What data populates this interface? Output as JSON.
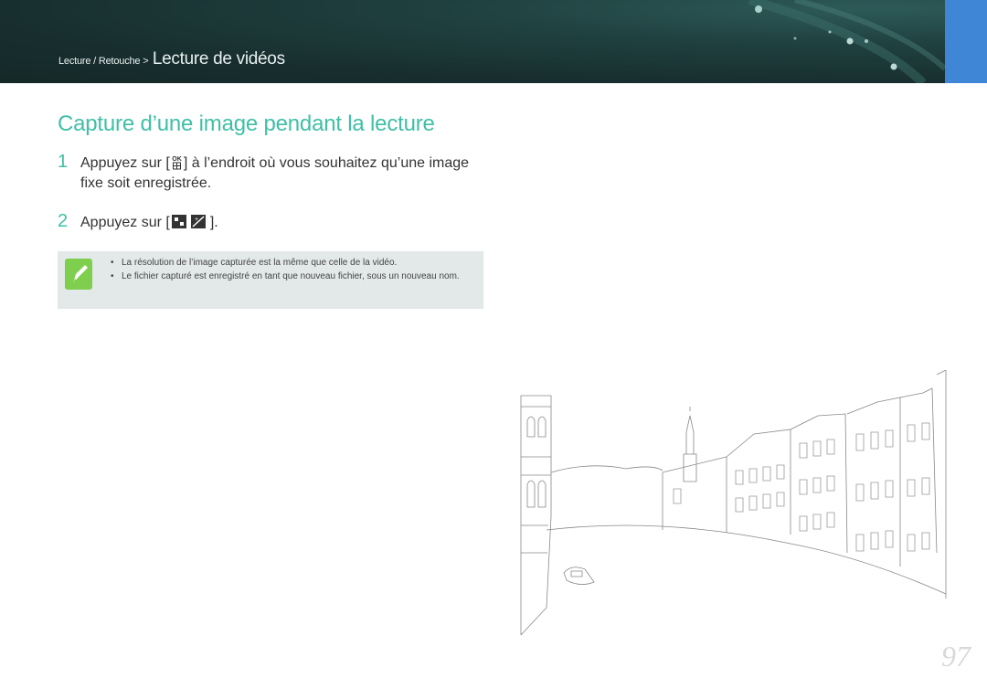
{
  "header": {
    "breadcrumb_prefix": "Lecture / Retouche >",
    "breadcrumb_current": "Lecture de vidéos"
  },
  "title": "Capture d’une image pendant la lecture",
  "steps": [
    {
      "number": "1",
      "text_before": "Appuyez sur [",
      "text_after": "] à l’endroit où vous souhaitez qu’une image fixe soit enregistrée.",
      "icon": "ok-button-icon"
    },
    {
      "number": "2",
      "text_before": "Appuyez sur [",
      "text_after": "].",
      "icon": "capture-buttons-icon"
    }
  ],
  "note": {
    "icon": "pen-note-icon",
    "items": [
      "La résolution de l’image capturée est la même que celle de la vidéo.",
      "Le fichier capturé est enregistré en tant que nouveau fichier, sous un nouveau nom."
    ]
  },
  "page_number": "97",
  "colors": {
    "accent": "#3fbfa5",
    "header_bg": "#1f403f",
    "tab": "#3f86d6",
    "note_bg": "#e3e8e8"
  }
}
